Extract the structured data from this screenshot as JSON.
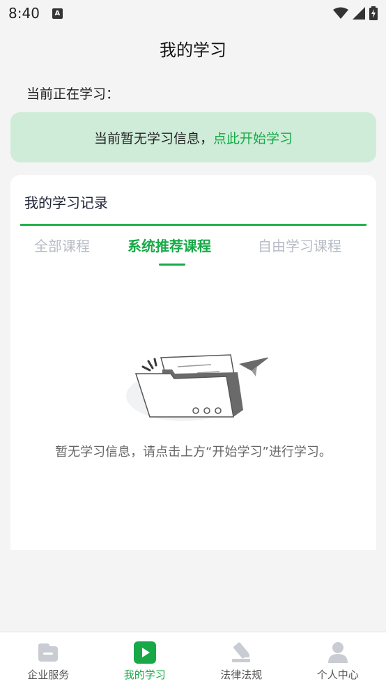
{
  "status": {
    "time": "8:40",
    "notification_icon": "a-letter-icon",
    "wifi_icon": "wifi-icon",
    "signal_icon": "signal-icon",
    "battery_icon": "battery-charging-icon"
  },
  "header": {
    "title": "我的学习"
  },
  "current": {
    "label": "当前正在学习：",
    "banner_text": "当前暂无学习信息，",
    "banner_link": "点此开始学习"
  },
  "records": {
    "title": "我的学习记录",
    "tabs": [
      {
        "label": "全部课程",
        "active": false
      },
      {
        "label": "系统推荐课程",
        "active": true
      },
      {
        "label": "自由学习课程",
        "active": false
      }
    ],
    "empty_illustration": "empty-folder-illustration",
    "empty_text": "暂无学习信息，请点击上方“开始学习”进行学习。"
  },
  "bottom_nav": [
    {
      "label": "企业服务",
      "icon": "briefcase-icon",
      "active": false
    },
    {
      "label": "我的学习",
      "icon": "play-icon",
      "active": true
    },
    {
      "label": "法律法规",
      "icon": "gavel-icon",
      "active": false
    },
    {
      "label": "个人中心",
      "icon": "user-icon",
      "active": false
    }
  ],
  "colors": {
    "accent": "#17a948",
    "banner_bg": "#cfecd8",
    "inactive_tab": "#b8bcc6",
    "nav_inactive_icon": "#c9ccd2"
  }
}
